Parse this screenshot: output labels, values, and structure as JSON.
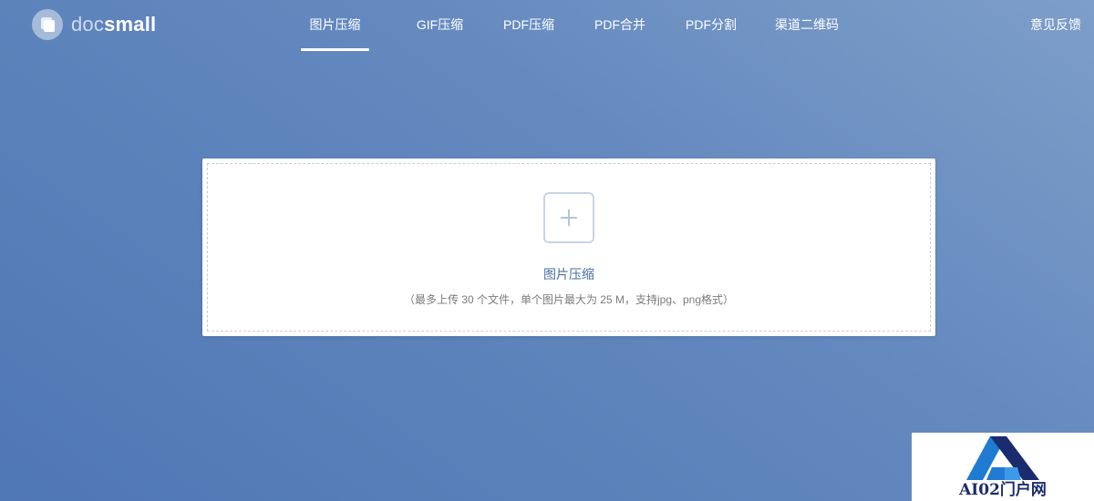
{
  "brand": {
    "name_part1": "doc",
    "name_part2": "small"
  },
  "nav": {
    "items": [
      {
        "label": "图片压缩",
        "active": true
      },
      {
        "label": "GIF压缩",
        "active": false
      },
      {
        "label": "PDF压缩",
        "active": false
      },
      {
        "label": "PDF合并",
        "active": false
      },
      {
        "label": "PDF分割",
        "active": false
      },
      {
        "label": "渠道二维码",
        "active": false
      }
    ],
    "feedback_label": "意见反馈"
  },
  "upload": {
    "icon": "plus-icon",
    "title": "图片压缩",
    "hint": "（最多上传 30 个文件，单个图片最大为 25 M，支持jpg、png格式）"
  },
  "watermark": {
    "text": "AI02门户网"
  },
  "colors": {
    "accent_text": "#4a6fa0",
    "background_top": "#7d9ec8",
    "background_bottom": "#4f77b4"
  }
}
